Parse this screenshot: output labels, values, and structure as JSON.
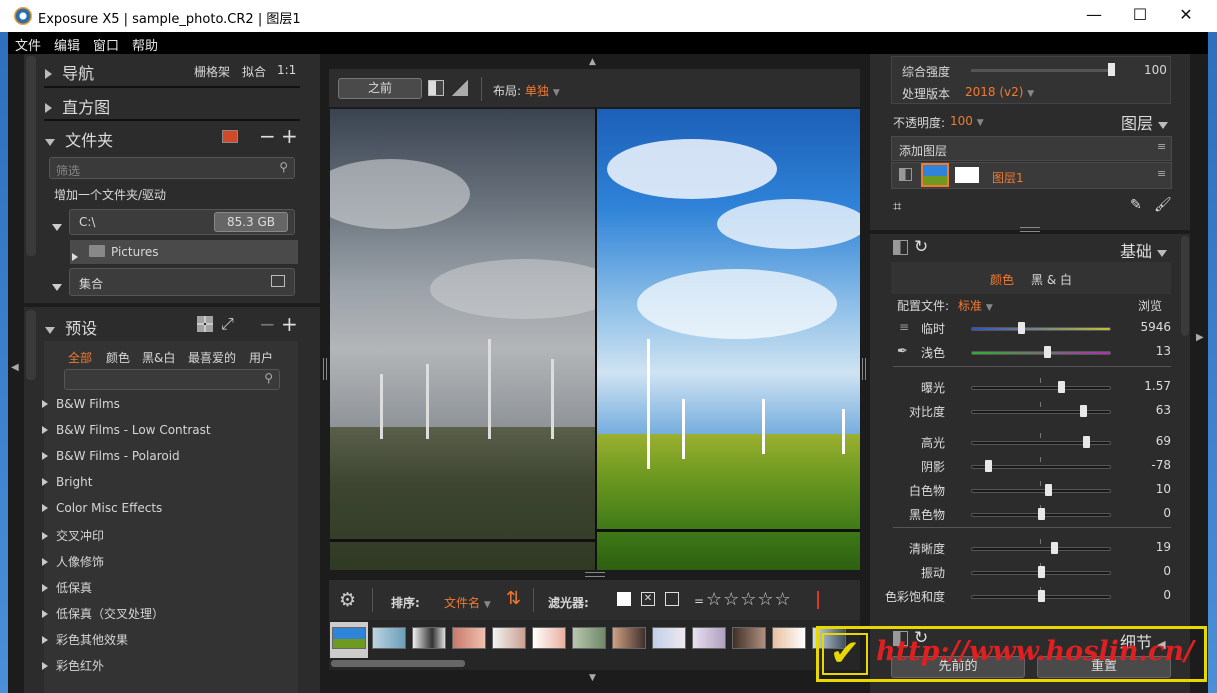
{
  "window": {
    "title": "Exposure X5 | sample_photo.CR2 | 图层1",
    "minimize_glyph": "—",
    "maximize_glyph": "☐",
    "close_glyph": "✕"
  },
  "menu": [
    "文件",
    "编辑",
    "窗口",
    "帮助"
  ],
  "left": {
    "nav": {
      "label": "导航",
      "grid": "栅格架",
      "fit": "拟合",
      "ratio": "1:1"
    },
    "histogram": {
      "label": "直方图"
    },
    "folders": {
      "label": "文件夹",
      "filter_placeholder": "筛选",
      "add_folder": "增加一个文件夹/驱动",
      "drive": "C:\\",
      "drive_size": "85.3 GB",
      "subfolder": "Pictures",
      "collections": "集合"
    },
    "presets": {
      "label": "预设",
      "tabs": [
        "全部",
        "颜色",
        "黑&白",
        "最喜爱的",
        "用户"
      ],
      "items": [
        "B&W Films",
        "B&W Films - Low Contrast",
        "B&W Films - Polaroid",
        "Bright",
        "Color Misc Effects",
        "交叉冲印",
        "人像修饰",
        "低保真",
        "低保真（交叉处理）",
        "彩色其他效果",
        "彩色红外"
      ]
    }
  },
  "center": {
    "before_button": "之前",
    "layout_label": "布局:",
    "layout_value": "单独",
    "sort_label": "排序:",
    "sort_value": "文件名",
    "filter_label": "滤光器:",
    "equals": "="
  },
  "right": {
    "strength_label": "综合强度",
    "strength_value": "100",
    "strength_level": 1.0,
    "process_label": "处理版本",
    "process_value": "2018 (v2)",
    "opacity_label": "不透明度:",
    "opacity_value": "100",
    "layers_title": "图层",
    "add_layer": "添加图层",
    "layer_name": "图层1",
    "basic_title": "基础",
    "color_tab": "颜色",
    "bw_tab": "黑 & 白",
    "profile_label": "配置文件:",
    "profile_value": "标准",
    "browse": "浏览",
    "sliders": [
      {
        "label": "临时",
        "value": "5946",
        "level": 0.36
      },
      {
        "label": "浅色",
        "value": "13",
        "level": 0.54
      },
      {
        "label": "曝光",
        "value": "1.57",
        "level": 0.64
      },
      {
        "label": "对比度",
        "value": "63",
        "level": 0.8
      },
      {
        "label": "高光",
        "value": "69",
        "level": 0.82
      },
      {
        "label": "阴影",
        "value": "-78",
        "level": 0.12
      },
      {
        "label": "白色物",
        "value": "10",
        "level": 0.55
      },
      {
        "label": "黑色物",
        "value": "0",
        "level": 0.5
      },
      {
        "label": "清晰度",
        "value": "19",
        "level": 0.59
      },
      {
        "label": "振动",
        "value": "0",
        "level": 0.5
      },
      {
        "label": "色彩饱和度",
        "value": "0",
        "level": 0.5
      }
    ],
    "detail_title": "细节",
    "prev_button": "先前的",
    "reset_button": "重置"
  },
  "watermark": "http://www.hoslin.cn/",
  "colors": {
    "accent": "#f07a30",
    "panel": "#2c2c2c",
    "watermark": "#e02020",
    "watermark_border": "#e8d800"
  }
}
